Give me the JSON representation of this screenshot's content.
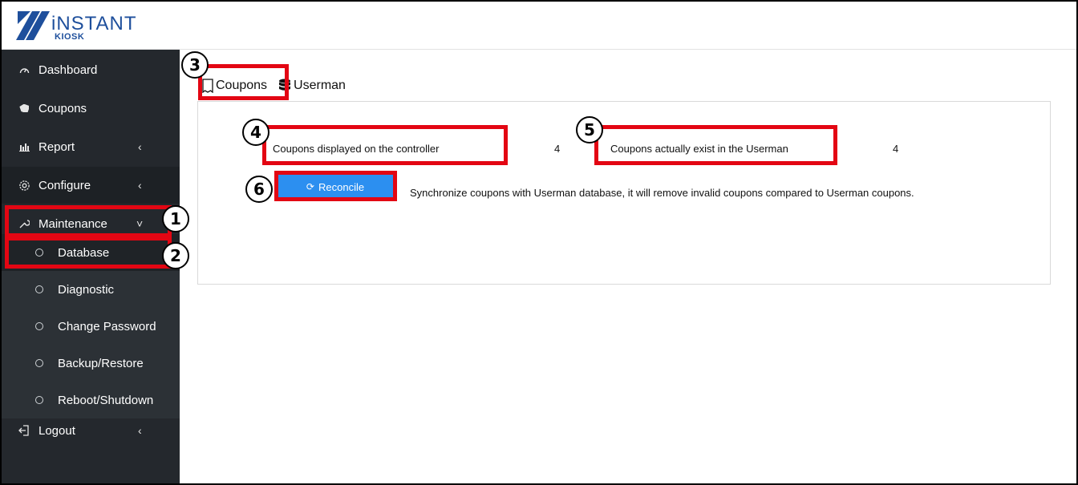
{
  "brand": {
    "name": "iNSTANT",
    "sub": "KIOSK"
  },
  "sidebar": {
    "items": [
      {
        "label": "Dashboard",
        "icon": "gauge-icon"
      },
      {
        "label": "Coupons",
        "icon": "tag-icon"
      },
      {
        "label": "Report",
        "icon": "bar-chart-icon",
        "chevron": "‹"
      },
      {
        "label": "Configure",
        "icon": "gear-icon",
        "chevron": "‹"
      },
      {
        "label": "Maintenance",
        "icon": "wrench-icon",
        "chevron": "˅"
      },
      {
        "label": "Logout",
        "icon": "logout-icon",
        "chevron": "‹"
      }
    ],
    "maintenance_sub": [
      {
        "label": "Database",
        "active": true
      },
      {
        "label": "Diagnostic"
      },
      {
        "label": "Change Password"
      },
      {
        "label": "Backup/Restore"
      },
      {
        "label": "Reboot/Shutdown"
      }
    ]
  },
  "tabs": [
    {
      "label": "Coupons",
      "icon": "receipt-icon",
      "active": true
    },
    {
      "label": "Userman",
      "icon": "database-icon"
    }
  ],
  "content": {
    "displayed_label": "Coupons displayed on the controller",
    "displayed_value": "4",
    "exist_label": "Coupons actually exist in the Userman",
    "exist_value": "4",
    "reconcile_label": "Reconcile",
    "description": "Synchronize coupons with Userman database, it will remove invalid coupons compared to Userman coupons."
  },
  "annotations": [
    "1",
    "2",
    "3",
    "4",
    "5",
    "6"
  ],
  "colors": {
    "sidebar": "#24282d",
    "highlight": "#e30613",
    "button": "#2c8ff0",
    "brand": "#1e4f9c"
  }
}
